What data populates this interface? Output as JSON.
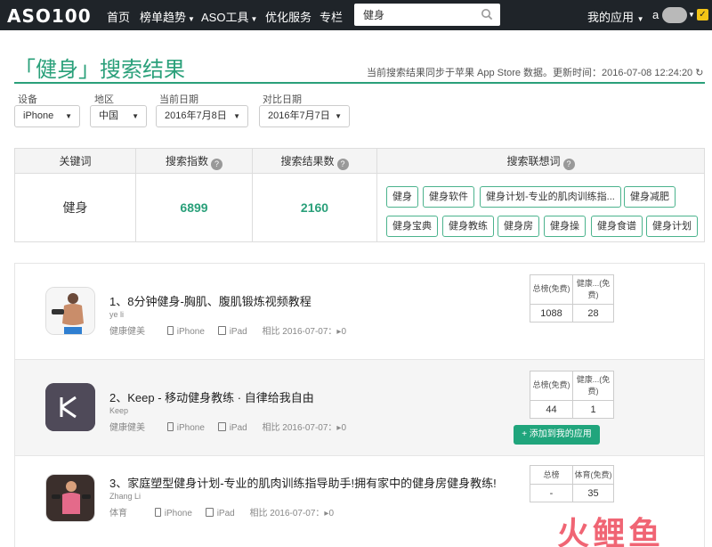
{
  "nav": {
    "logo": "ASO100",
    "items": [
      {
        "label": "首页",
        "caret": false
      },
      {
        "label": "榜单趋势",
        "caret": true
      },
      {
        "label": "ASO工具",
        "caret": true
      },
      {
        "label": "优化服务",
        "caret": false
      },
      {
        "label": "专栏",
        "caret": false
      }
    ],
    "search_value": "健身",
    "my_apps": "我的应用",
    "user": "a"
  },
  "header": {
    "title": "「健身」搜索结果",
    "sync_info": "当前搜索结果同步于苹果 App Store 数据。更新时间：2016-07-08 12:24:20"
  },
  "filters": {
    "device": {
      "label": "设备",
      "value": "iPhone"
    },
    "region": {
      "label": "地区",
      "value": "中国"
    },
    "current_date": {
      "label": "当前日期",
      "value": "2016年7月8日"
    },
    "compare_date": {
      "label": "对比日期",
      "value": "2016年7月7日"
    }
  },
  "summary": {
    "headers": [
      "关键词",
      "搜索指数",
      "搜索结果数",
      "搜索联想词"
    ],
    "keyword": "健身",
    "search_index": "6899",
    "result_count": "2160",
    "suggestions": [
      "健身",
      "健身软件",
      "健身计划-专业的肌肉训练指...",
      "健身减肥",
      "健身宝典",
      "健身教练",
      "健身房",
      "健身操",
      "健身食谱",
      "健身计划"
    ]
  },
  "apps": [
    {
      "title": "1、8分钟健身-胸肌、腹肌锻炼视频教程",
      "developer": "ye li",
      "category": "健康健美",
      "iphone": "iPhone",
      "ipad": "iPad",
      "compare": "相比 2016-07-07：▸0",
      "rank_headers": [
        "总榜(免费)",
        "健康...(免费)"
      ],
      "rank_values": [
        "1088",
        "28"
      ]
    },
    {
      "title": "2、Keep - 移动健身教练 · 自律给我自由",
      "developer": "Keep",
      "category": "健康健美",
      "iphone": "iPhone",
      "ipad": "iPad",
      "compare": "相比 2016-07-07：▸0",
      "rank_headers": [
        "总榜(免费)",
        "健康...(免费)"
      ],
      "rank_values": [
        "44",
        "1"
      ],
      "add_button": "+ 添加到我的应用"
    },
    {
      "title": "3、家庭塑型健身计划-专业的肌肉训练指导助手!拥有家中的健身房健身教练!",
      "developer": "Zhang Li",
      "category": "体育",
      "iphone": "iPhone",
      "ipad": "iPad",
      "compare": "相比 2016-07-07：▸0",
      "rank_headers": [
        "总榜",
        "体育(免费)"
      ],
      "rank_values": [
        "-",
        "35"
      ]
    }
  ],
  "watermark": "火鲤鱼",
  "colors": {
    "accent": "#2aa07a",
    "nav_bg": "#1f2429",
    "button": "#20a57c"
  }
}
